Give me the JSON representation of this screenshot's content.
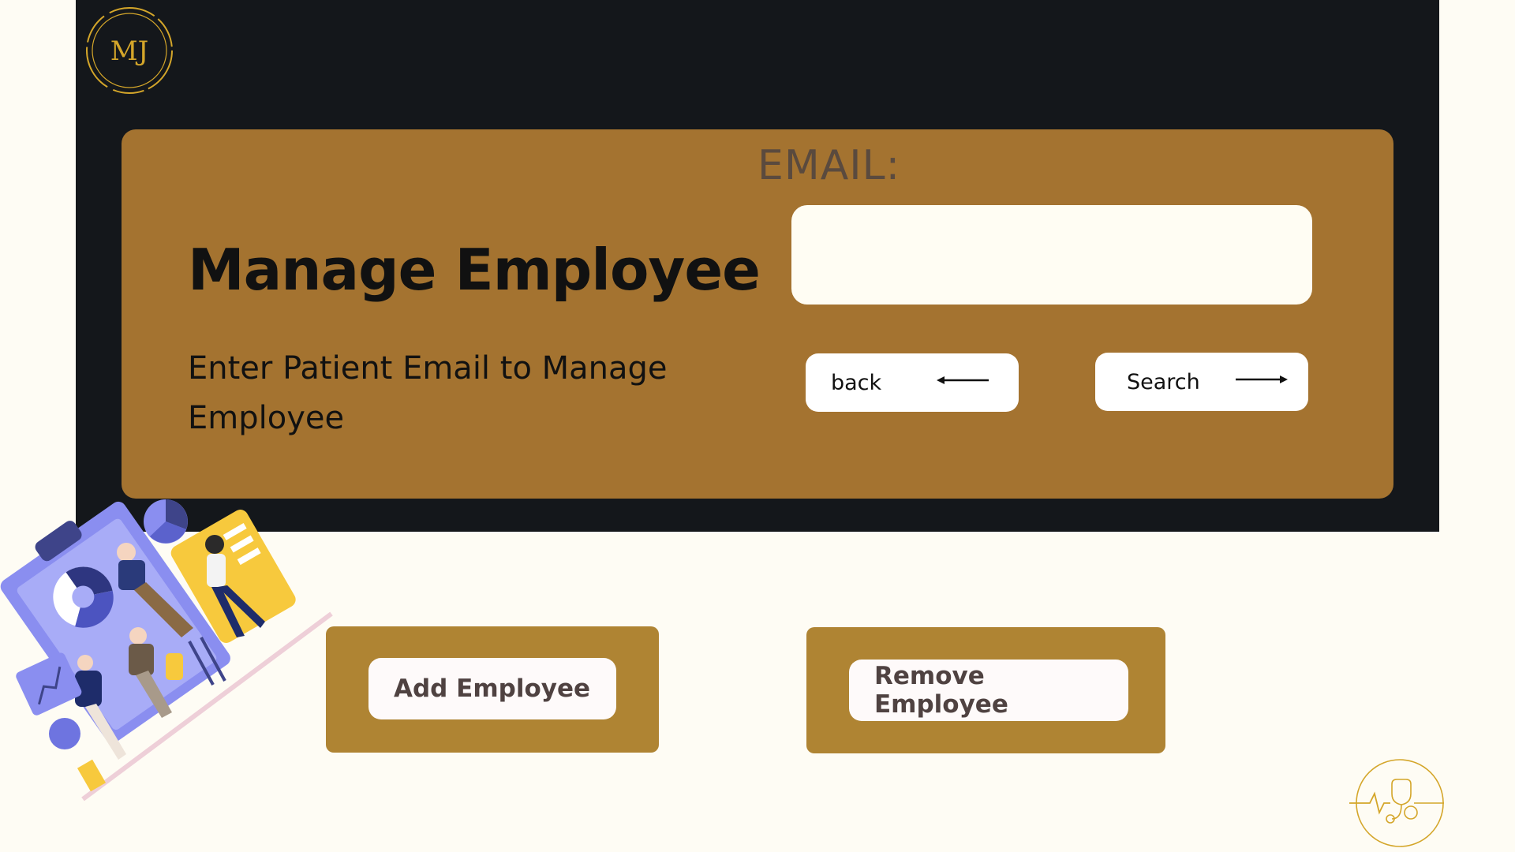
{
  "brand": {
    "logo_text": "MJ"
  },
  "card": {
    "email_label": "EMAIL:",
    "email_value": "",
    "title": "Manage Employee",
    "subtitle": "Enter Patient Email to Manage Employee",
    "back_label": "back",
    "search_label": "Search"
  },
  "actions": {
    "add_label": "Add Employee",
    "remove_label": "Remove  Employee"
  },
  "colors": {
    "page_bg": "#fefcf4",
    "panel_bg": "#14171b",
    "card_bg": "#a47330",
    "action_bg": "#af8433",
    "gold": "#d4a62a",
    "action_text": "#4f4241"
  },
  "icons": {
    "logo": "mj-monogram-circle",
    "back": "arrow-left-icon",
    "search": "arrow-right-icon",
    "badge": "heartbeat-stethoscope-badge",
    "illustration": "team-dashboard-illustration"
  }
}
